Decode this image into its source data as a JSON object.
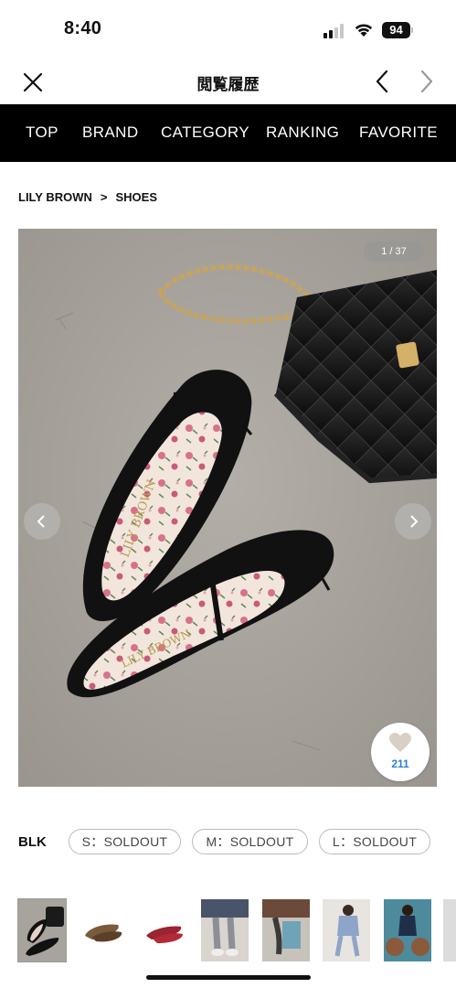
{
  "status": {
    "time": "8:40",
    "battery": "94"
  },
  "header": {
    "title": "閲覧履歴"
  },
  "nav": {
    "items": [
      "TOP",
      "BRAND",
      "CATEGORY",
      "RANKING",
      "FAVORITE"
    ]
  },
  "breadcrumb": {
    "brand": "LILY BROWN",
    "separator": ">",
    "category": "SHOES"
  },
  "gallery": {
    "counter": "1 / 37",
    "favorite_count": "211"
  },
  "variants": {
    "color": "BLK",
    "sizes": [
      "S：SOLDOUT",
      "M：SOLDOUT",
      "L：SOLDOUT"
    ]
  },
  "thumbnails": [
    "shoes-and-bag",
    "leopard-shoes",
    "red-shoes",
    "model-legs-grey",
    "model-bench",
    "model-blue",
    "model-teddy",
    "partial"
  ],
  "colors": {
    "nav_bg": "#000000",
    "favorite_count": "#2a7fd4",
    "accent": "#111111"
  }
}
